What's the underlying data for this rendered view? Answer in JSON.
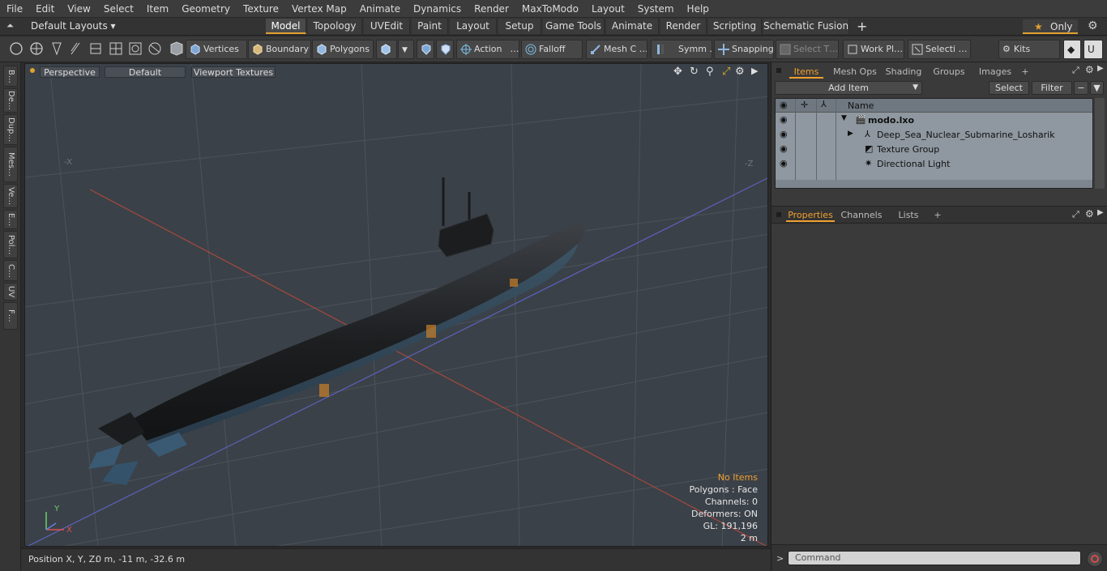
{
  "menubar": {
    "items": [
      "File",
      "Edit",
      "View",
      "Select",
      "Item",
      "Geometry",
      "Texture",
      "Vertex Map",
      "Animate",
      "Dynamics",
      "Render",
      "MaxToModo",
      "Layout",
      "System",
      "Help"
    ]
  },
  "layoutbar": {
    "layout_select": "Default Layouts ▾",
    "tabs": [
      "Model",
      "Topology",
      "UVEdit",
      "Paint",
      "Layout",
      "Setup",
      "Game Tools",
      "Animate",
      "Render",
      "Scripting",
      "Schematic Fusion"
    ],
    "active_tab": "Model",
    "plus": "+",
    "only_label": "Only",
    "star": "★"
  },
  "toolbar": {
    "vertices": "Vertices",
    "boundary": "Boundary",
    "polygons": "Polygons",
    "action": "Action",
    "action_more": "…",
    "falloff": "Falloff",
    "mesh_constraints": "Mesh C …",
    "symmetry": "Symm …",
    "snapping": "Snapping",
    "select_through": "Select T…",
    "work_plane": "Work Pl…",
    "selection_sets": "Selecti …",
    "kits": "Kits"
  },
  "left_strip": {
    "tabs": [
      "B…",
      "De…",
      "Dup…",
      "Mes…",
      "Ve…",
      "E…",
      "Pol…",
      "C…",
      "UV",
      "F…"
    ]
  },
  "viewport": {
    "view_type": "Perspective",
    "shading": "Default",
    "texture_mode": "Viewport Textures",
    "axis_x_neg": "-X",
    "axis_z_neg": "-Z",
    "stats": {
      "selection": "No Items",
      "polygons": "Polygons : Face",
      "channels": "Channels: 0",
      "deformers": "Deformers: ON",
      "gl": "GL: 191,196",
      "scale": "2 m"
    },
    "gizmo": {
      "x": "X",
      "y": "Y"
    }
  },
  "statusbar": {
    "position_label": "Position X, Y, Z:",
    "position_value": "0 m, -11 m, -32.6 m"
  },
  "items_panel": {
    "tabs": [
      "Items",
      "Mesh Ops",
      "Shading",
      "Groups",
      "Images"
    ],
    "active_tab": "Items",
    "plus": "+",
    "add_item": "Add Item",
    "select_btn": "Select",
    "filter_btn": "Filter",
    "column_name": "Name",
    "rows": [
      {
        "label": "modo.lxo",
        "bold": true
      },
      {
        "label": "Deep_Sea_Nuclear_Submarine_Losharik",
        "bold": false
      },
      {
        "label": "Texture Group",
        "bold": false
      },
      {
        "label": "Directional Light",
        "bold": false
      }
    ]
  },
  "properties_panel": {
    "tabs": [
      "Properties",
      "Channels",
      "Lists"
    ],
    "active_tab": "Properties",
    "plus": "+"
  },
  "command": {
    "prompt": ">",
    "placeholder": "Command"
  },
  "colors": {
    "accent": "#f0a030",
    "viewport_bg": "#3b4148",
    "list_bg": "#8f98a0"
  }
}
